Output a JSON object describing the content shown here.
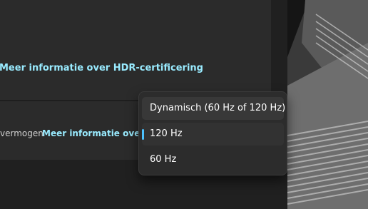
{
  "hdr_card": {
    "link_label": "Meer informatie over HDR-certificering"
  },
  "refresh_card": {
    "description_fragment": "vermogen",
    "link_label": "Meer informatie over"
  },
  "refresh_dropdown": {
    "options": [
      {
        "label": "Dynamisch (60 Hz of 120 Hz)",
        "state": "hover"
      },
      {
        "label": "120 Hz",
        "state": "selected"
      },
      {
        "label": "60 Hz",
        "state": "normal"
      }
    ],
    "selected_value": "120 Hz"
  },
  "colors": {
    "accent": "#4cc2ff",
    "link": "#99ebff",
    "background": "#202020",
    "card": "#2b2b2b",
    "flyout": "#2c2c2c"
  }
}
